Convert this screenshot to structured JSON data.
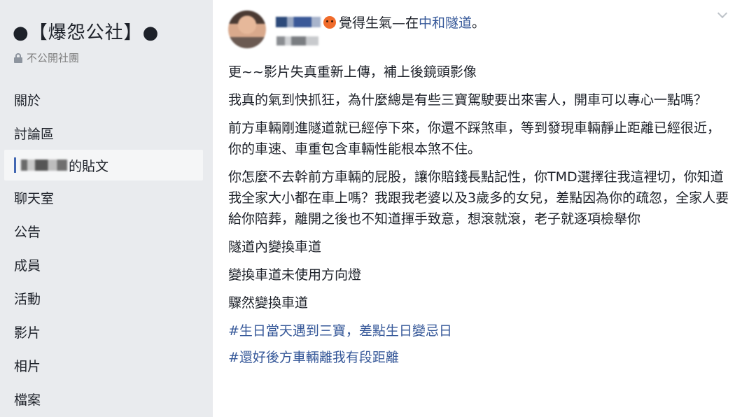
{
  "sidebar": {
    "group_name": "●【爆怨公社】●",
    "privacy_label": "不公開社團",
    "items": [
      {
        "label": "關於"
      },
      {
        "label": "討論區"
      },
      {
        "label": "的貼文"
      },
      {
        "label": "聊天室"
      },
      {
        "label": "公告"
      },
      {
        "label": "成員"
      },
      {
        "label": "活動"
      },
      {
        "label": "影片"
      },
      {
        "label": "相片"
      },
      {
        "label": "檔案"
      }
    ]
  },
  "post": {
    "feeling_text": "覺得生氣",
    "separator": "—在",
    "location": "中和隧道",
    "period": "。",
    "paragraphs": [
      "更~~影片失真重新上傳，補上後鏡頭影像",
      "我真的氣到快抓狂，為什麼總是有些三寶駕駛要出來害人，開車可以專心一點嗎？",
      "前方車輛剛進隧道就已經停下來，你還不踩煞車，等到發現車輛靜止距離已經很近，你的車速、車重包含車輛性能根本煞不住。",
      "你怎麼不去幹前方車輛的屁股，讓你賠錢長點記性，你TMD選擇往我這裡切，你知道我全家大小都在車上嗎？我跟我老婆以及3歲多的女兒，差點因為你的疏忽，全家人要給你陪葬，離開之後也不知道揮手致意，想滾就滾，老子就逐項檢舉你",
      "隧道內變換車道",
      "變換車道未使用方向燈",
      "驟然變換車道"
    ],
    "hashtags": [
      "#生日當天遇到三寶，差點生日變忌日",
      "#還好後方車輛離我有段距離"
    ]
  },
  "colors": {
    "link": "#365899",
    "accent": "#4267b2",
    "background": "#e9ebee"
  },
  "icons": [
    "lock-icon",
    "angry-emoji-icon",
    "chevron-down-icon"
  ]
}
